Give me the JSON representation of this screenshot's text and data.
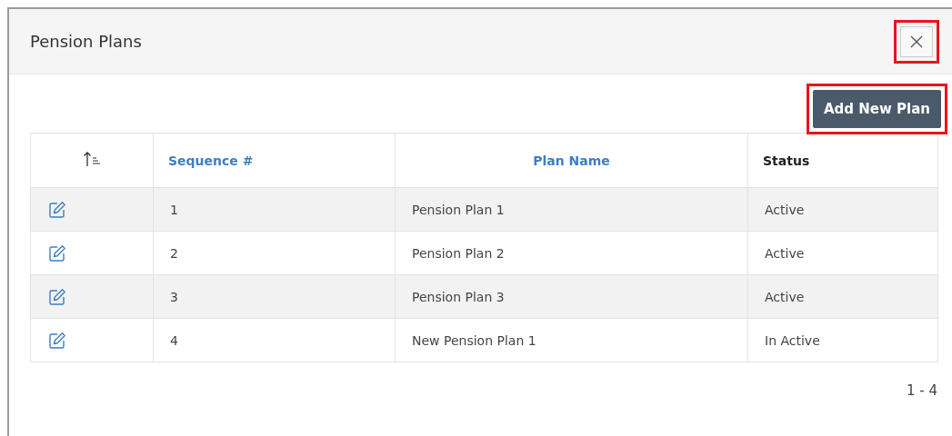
{
  "dialog": {
    "title": "Pension Plans",
    "close_button": {
      "highlighted": true
    }
  },
  "add_button": {
    "label": "Add New Plan",
    "highlighted": true
  },
  "table": {
    "columns": [
      {
        "label": "Sequence #",
        "sortable": true
      },
      {
        "label": "Plan Name",
        "sortable": true
      },
      {
        "label": "Status",
        "sortable": false
      }
    ],
    "rows": [
      {
        "sequence": "1",
        "plan_name": "Pension Plan 1",
        "status": "Active"
      },
      {
        "sequence": "2",
        "plan_name": "Pension Plan 2",
        "status": "Active"
      },
      {
        "sequence": "3",
        "plan_name": "Pension Plan 3",
        "status": "Active"
      },
      {
        "sequence": "4",
        "plan_name": "New Pension Plan 1",
        "status": "In Active"
      }
    ]
  },
  "pagination": "1 - 4"
}
